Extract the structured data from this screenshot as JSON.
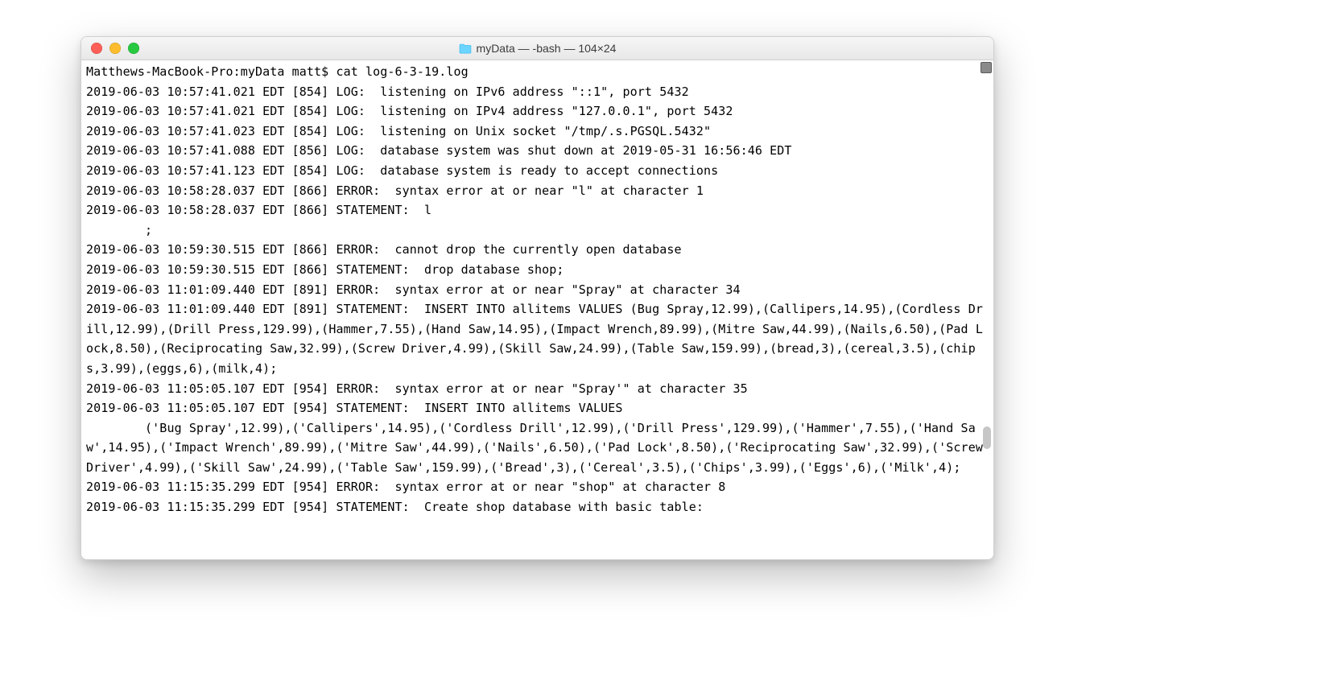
{
  "window": {
    "title": "myData — -bash — 104×24"
  },
  "terminal": {
    "prompt": "Matthews-MacBook-Pro:myData matt$ ",
    "command": "cat log-6-3-19.log",
    "output": "2019-06-03 10:57:41.021 EDT [854] LOG:  listening on IPv6 address \"::1\", port 5432\n2019-06-03 10:57:41.021 EDT [854] LOG:  listening on IPv4 address \"127.0.0.1\", port 5432\n2019-06-03 10:57:41.023 EDT [854] LOG:  listening on Unix socket \"/tmp/.s.PGSQL.5432\"\n2019-06-03 10:57:41.088 EDT [856] LOG:  database system was shut down at 2019-05-31 16:56:46 EDT\n2019-06-03 10:57:41.123 EDT [854] LOG:  database system is ready to accept connections\n2019-06-03 10:58:28.037 EDT [866] ERROR:  syntax error at or near \"l\" at character 1\n2019-06-03 10:58:28.037 EDT [866] STATEMENT:  l\n        ;\n2019-06-03 10:59:30.515 EDT [866] ERROR:  cannot drop the currently open database\n2019-06-03 10:59:30.515 EDT [866] STATEMENT:  drop database shop;\n2019-06-03 11:01:09.440 EDT [891] ERROR:  syntax error at or near \"Spray\" at character 34\n2019-06-03 11:01:09.440 EDT [891] STATEMENT:  INSERT INTO allitems VALUES (Bug Spray,12.99),(Callipers,14.95),(Cordless Drill,12.99),(Drill Press,129.99),(Hammer,7.55),(Hand Saw,14.95),(Impact Wrench,89.99),(Mitre Saw,44.99),(Nails,6.50),(Pad Lock,8.50),(Reciprocating Saw,32.99),(Screw Driver,4.99),(Skill Saw,24.99),(Table Saw,159.99),(bread,3),(cereal,3.5),(chips,3.99),(eggs,6),(milk,4);\n2019-06-03 11:05:05.107 EDT [954] ERROR:  syntax error at or near \"Spray'\" at character 35\n2019-06-03 11:05:05.107 EDT [954] STATEMENT:  INSERT INTO allitems VALUES\n        ('Bug Spray',12.99),('Callipers',14.95),('Cordless Drill',12.99),('Drill Press',129.99),('Hammer',7.55),('Hand Saw',14.95),('Impact Wrench',89.99),('Mitre Saw',44.99),('Nails',6.50),('Pad Lock',8.50),('Reciprocating Saw',32.99),('Screw Driver',4.99),('Skill Saw',24.99),('Table Saw',159.99),('Bread',3),('Cereal',3.5),('Chips',3.99),('Eggs',6),('Milk',4);\n2019-06-03 11:15:35.299 EDT [954] ERROR:  syntax error at or near \"shop\" at character 8\n2019-06-03 11:15:35.299 EDT [954] STATEMENT:  Create shop database with basic table:"
  }
}
